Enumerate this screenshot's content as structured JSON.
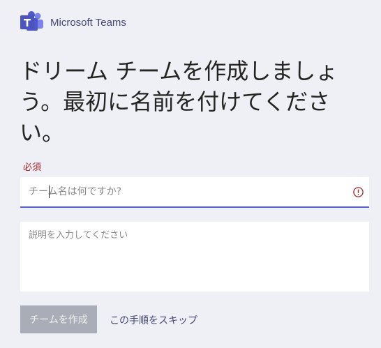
{
  "header": {
    "brand": "Microsoft Teams"
  },
  "main": {
    "heading": "ドリーム チームを作成しましょう。最初に名前を付けてください。",
    "required_label": "必須",
    "team_name": {
      "placeholder": "チーム名は何ですか?",
      "value": ""
    },
    "description": {
      "placeholder": "説明を入力してください",
      "value": ""
    },
    "create_button_label": "チームを作成",
    "skip_link_label": "この手順をスキップ"
  },
  "icons": {
    "logo": "teams-logo-icon",
    "error": "error-circle-icon"
  },
  "colors": {
    "brand": "#464775",
    "accent": "#5b5fc7",
    "error": "#a4262c",
    "disabled_button": "#a9adb7",
    "background": "#eef0f5"
  }
}
